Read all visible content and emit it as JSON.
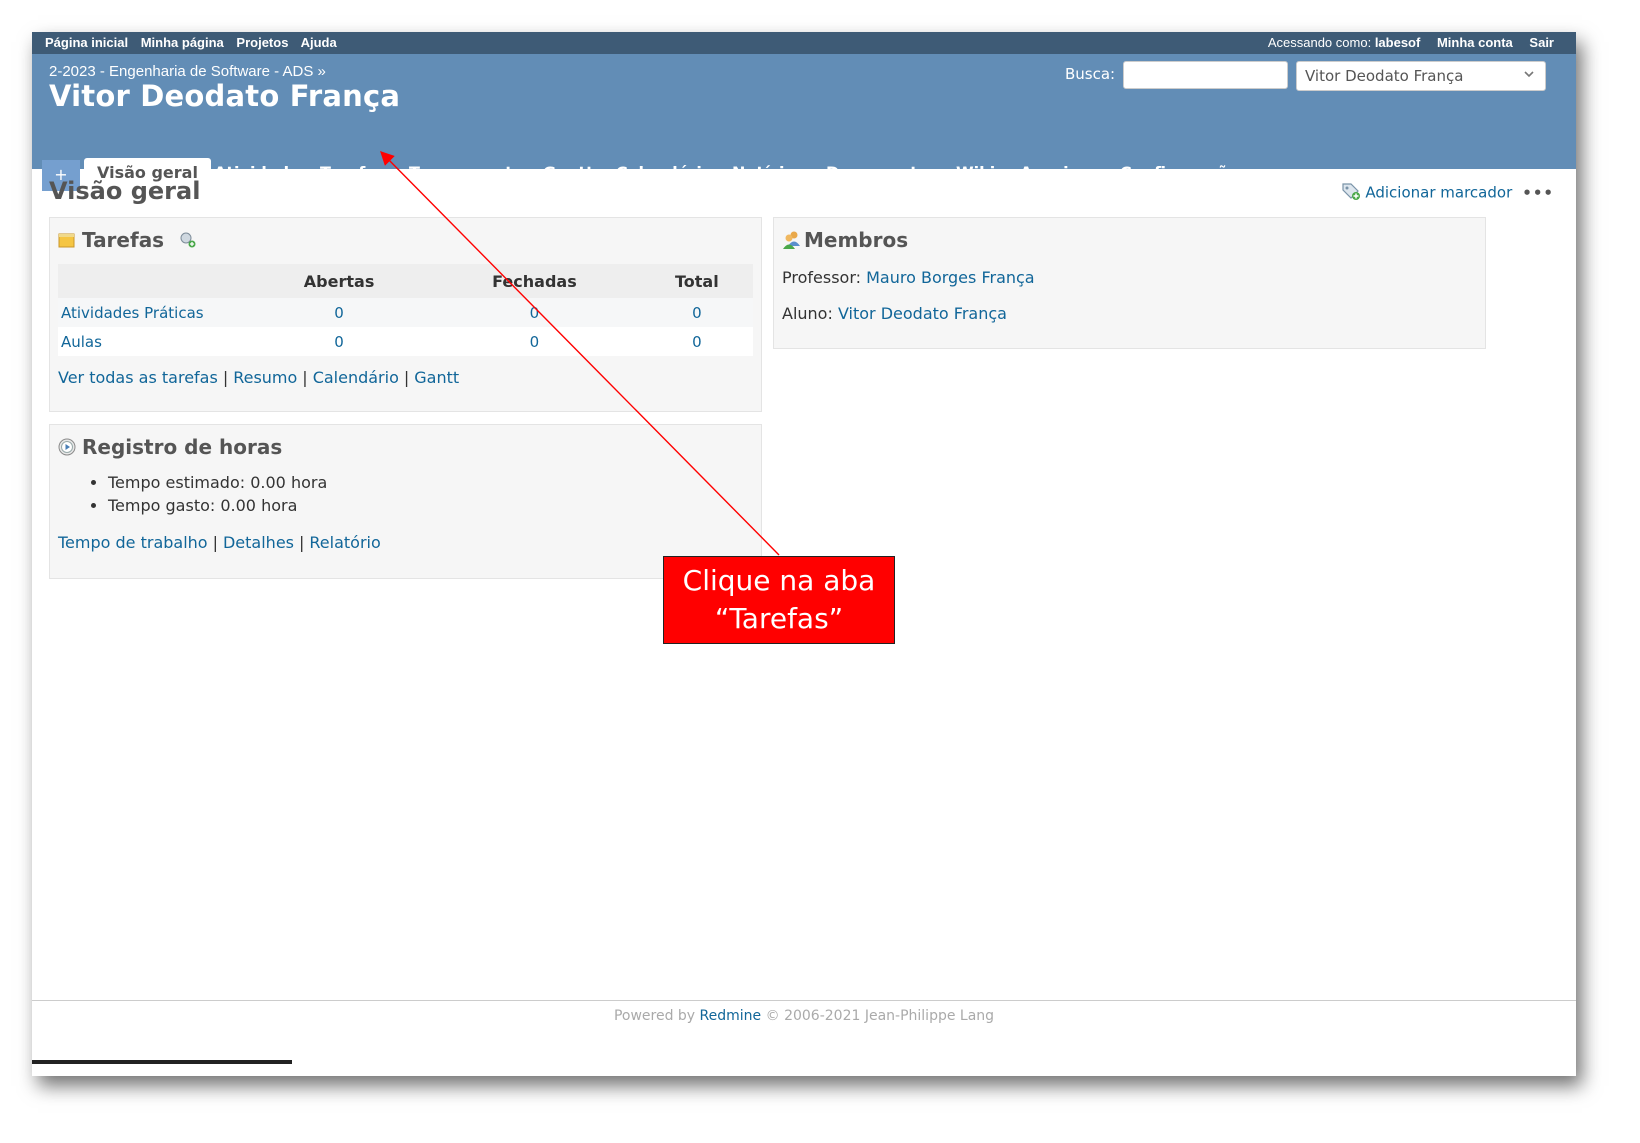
{
  "top_menu": {
    "left_items": [
      "Página inicial",
      "Minha página",
      "Projetos",
      "Ajuda"
    ],
    "logged_as_label": "Acessando como:",
    "user": "labesof",
    "my_account": "Minha conta",
    "logout": "Sair"
  },
  "header": {
    "parent_project": "2-2023 - Engenharia de Software - ADS »",
    "title": "Vitor Deodato França",
    "search_label": "Busca:",
    "search_value": "",
    "project_jump_selected": "Vitor Deodato França"
  },
  "tabs": {
    "plus": "+",
    "items": [
      "Visão geral",
      "Atividade",
      "Tarefas",
      "Tempo gasto",
      "Gantt",
      "Calendário",
      "Notícias",
      "Documentos",
      "Wiki",
      "Arquivos",
      "Configurações"
    ],
    "selected": "Visão geral"
  },
  "content": {
    "title": "Visão geral",
    "add_bookmark": "Adicionar marcador",
    "more": "•••"
  },
  "issues_box": {
    "title": "Tarefas",
    "columns": [
      "",
      "Abertas",
      "Fechadas",
      "Total"
    ],
    "rows": [
      {
        "name": "Atividades Práticas",
        "open": "0",
        "closed": "0",
        "total": "0"
      },
      {
        "name": "Aulas",
        "open": "0",
        "closed": "0",
        "total": "0"
      }
    ],
    "links": [
      "Ver todas as tarefas",
      "Resumo",
      "Calendário",
      "Gantt"
    ]
  },
  "time_box": {
    "title": "Registro de horas",
    "items": [
      "Tempo estimado: 0.00 hora",
      "Tempo gasto: 0.00 hora"
    ],
    "links": [
      "Tempo de trabalho",
      "Detalhes",
      "Relatório"
    ]
  },
  "members_box": {
    "title": "Membros",
    "rows": [
      {
        "role": "Professor:",
        "name": "Mauro Borges França"
      },
      {
        "role": "Aluno:",
        "name": "Vitor Deodato França"
      }
    ]
  },
  "footer": {
    "powered_by": "Powered by",
    "redmine": "Redmine",
    "copyright": "© 2006-2021 Jean-Philippe Lang"
  },
  "annotation": {
    "line1": "Clique na aba",
    "line2": "“Tarefas”",
    "color": "#ff0000"
  },
  "colors": {
    "header": "#628db6",
    "top_menu": "#3e5b76",
    "link": "#116699"
  }
}
